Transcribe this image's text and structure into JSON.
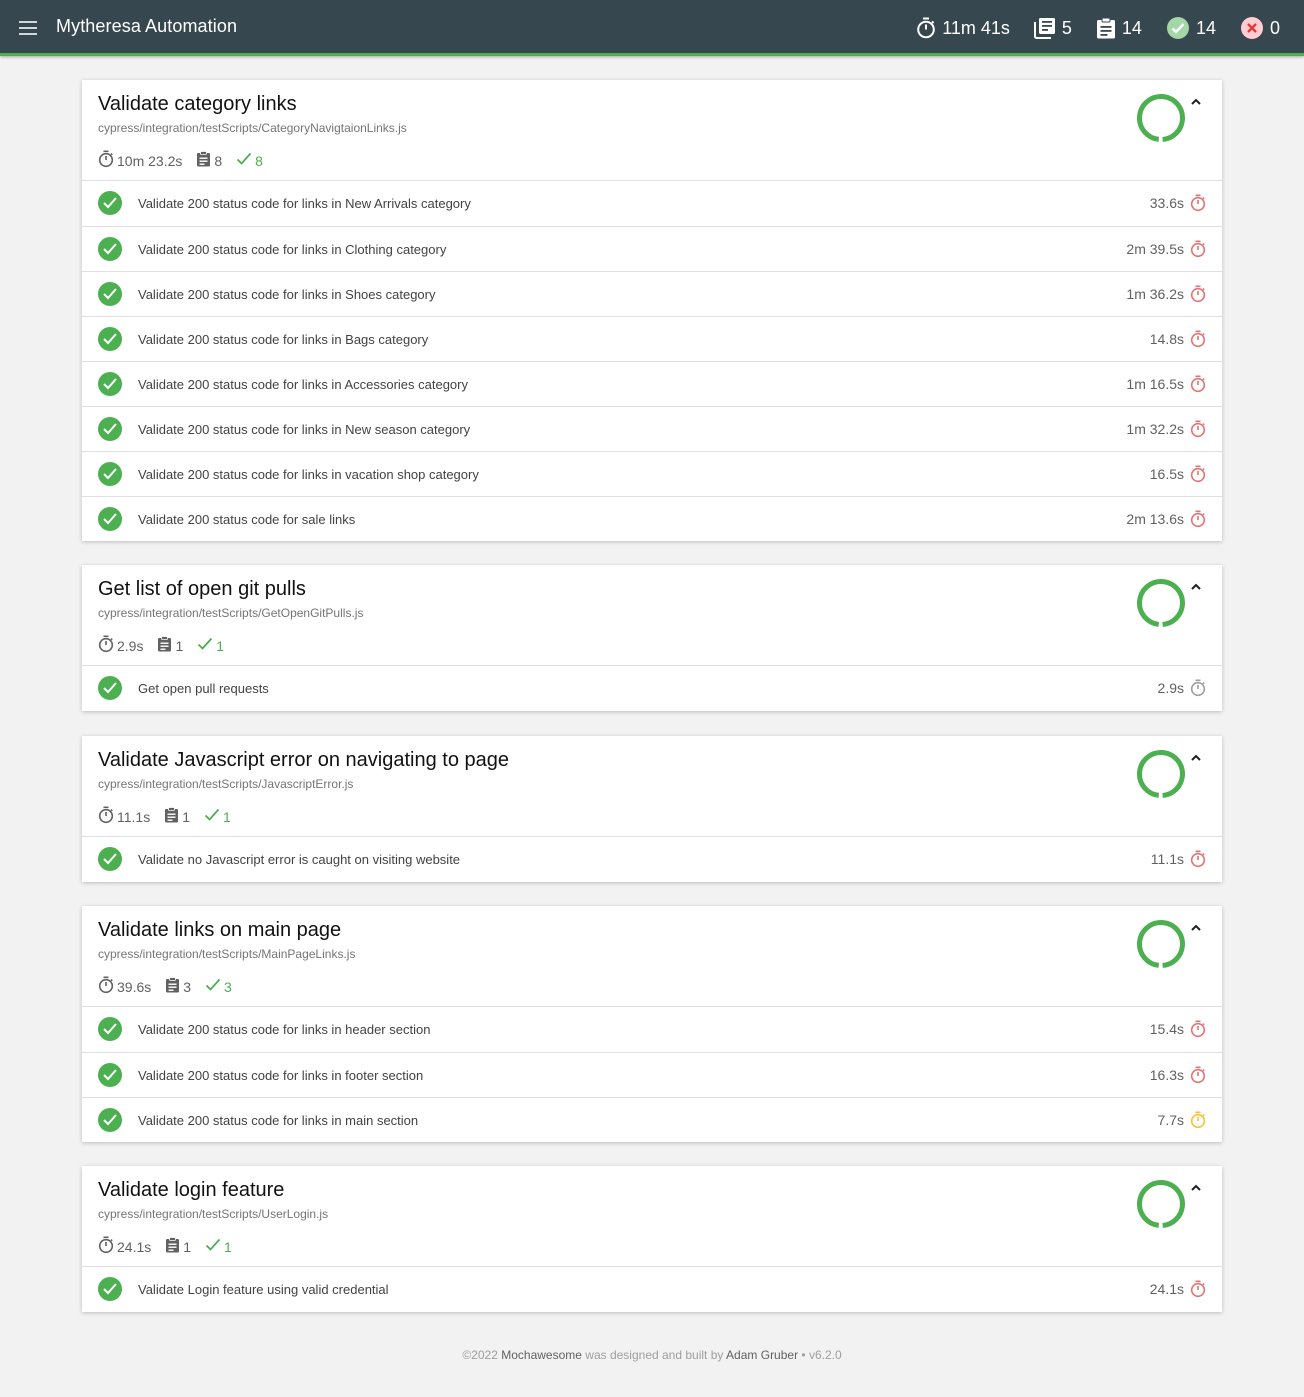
{
  "app": {
    "title": "Mytheresa Automation"
  },
  "stats": {
    "duration": "11m 41s",
    "suites": "5",
    "tests": "14",
    "passes": "14",
    "failures": "0"
  },
  "colors": {
    "navbar": "#37474f",
    "pass": "#4caf50",
    "fail": "#f44336",
    "slow": "#e57373",
    "medium": "#fbc02d",
    "fast": "#9e9e9e"
  },
  "suites": [
    {
      "title": "Validate category links",
      "file": "cypress/integration/testScripts/CategoryNavigtaionLinks.js",
      "duration": "10m 23.2s",
      "tests": "8",
      "passes": "8",
      "items": [
        {
          "name": "Validate 200 status code for links in New Arrivals category",
          "duration": "33.6s",
          "speed": "slow"
        },
        {
          "name": "Validate 200 status code for links in Clothing category",
          "duration": "2m 39.5s",
          "speed": "slow"
        },
        {
          "name": "Validate 200 status code for links in Shoes category",
          "duration": "1m 36.2s",
          "speed": "slow"
        },
        {
          "name": "Validate 200 status code for links in Bags category",
          "duration": "14.8s",
          "speed": "slow"
        },
        {
          "name": "Validate 200 status code for links in Accessories category",
          "duration": "1m 16.5s",
          "speed": "slow"
        },
        {
          "name": "Validate 200 status code for links in New season category",
          "duration": "1m 32.2s",
          "speed": "slow"
        },
        {
          "name": "Validate 200 status code for links in vacation shop category",
          "duration": "16.5s",
          "speed": "slow"
        },
        {
          "name": "Validate 200 status code for sale links",
          "duration": "2m 13.6s",
          "speed": "slow"
        }
      ]
    },
    {
      "title": "Get list of open git pulls",
      "file": "cypress/integration/testScripts/GetOpenGitPulls.js",
      "duration": "2.9s",
      "tests": "1",
      "passes": "1",
      "items": [
        {
          "name": "Get open pull requests",
          "duration": "2.9s",
          "speed": "fast"
        }
      ]
    },
    {
      "title": "Validate Javascript error on navigating to page",
      "file": "cypress/integration/testScripts/JavascriptError.js",
      "duration": "11.1s",
      "tests": "1",
      "passes": "1",
      "items": [
        {
          "name": "Validate no Javascript error is caught on visiting website",
          "duration": "11.1s",
          "speed": "slow"
        }
      ]
    },
    {
      "title": "Validate links on main page",
      "file": "cypress/integration/testScripts/MainPageLinks.js",
      "duration": "39.6s",
      "tests": "3",
      "passes": "3",
      "items": [
        {
          "name": "Validate 200 status code for links in header section",
          "duration": "15.4s",
          "speed": "slow"
        },
        {
          "name": "Validate 200 status code for links in footer section",
          "duration": "16.3s",
          "speed": "slow"
        },
        {
          "name": "Validate 200 status code for links in main section",
          "duration": "7.7s",
          "speed": "medium"
        }
      ]
    },
    {
      "title": "Validate login feature",
      "file": "cypress/integration/testScripts/UserLogin.js",
      "duration": "24.1s",
      "tests": "1",
      "passes": "1",
      "items": [
        {
          "name": "Validate Login feature using valid credential",
          "duration": "24.1s",
          "speed": "slow"
        }
      ]
    }
  ],
  "footer": {
    "copyright": "©2022",
    "product": "Mochawesome",
    "middle": "was designed and built by",
    "author": "Adam Gruber",
    "version": "• v6.2.0"
  }
}
